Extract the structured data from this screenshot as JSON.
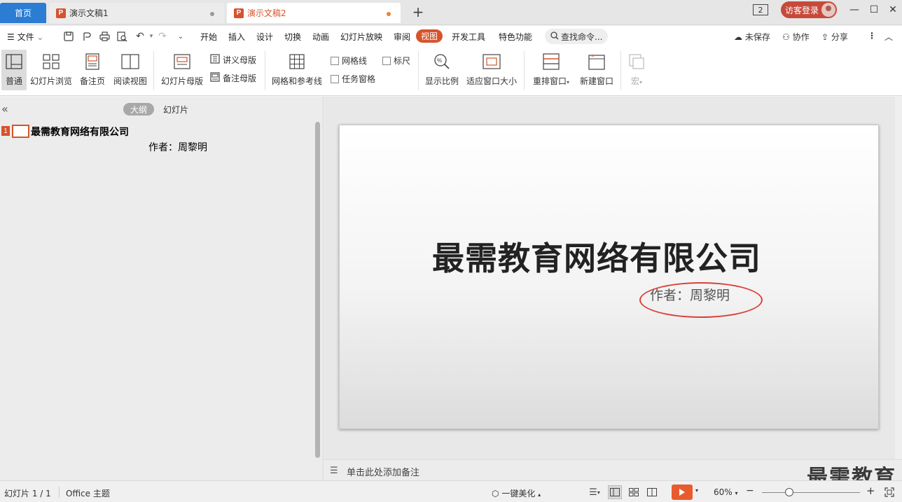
{
  "tabs": {
    "home": "首页",
    "doc1": "演示文稿1",
    "doc2": "演示文稿2",
    "badge": "P",
    "add": "+"
  },
  "titlebar": {
    "window_count": "2",
    "login": "访客登录",
    "minimize": "—",
    "maximize": "☐",
    "close": "✕"
  },
  "menu": {
    "file": "文件",
    "items": [
      "开始",
      "插入",
      "设计",
      "切换",
      "动画",
      "幻灯片放映",
      "审阅",
      "视图",
      "开发工具",
      "特色功能"
    ],
    "search": "查找命令...",
    "unsaved": "未保存",
    "collab": "协作",
    "share": "分享"
  },
  "ribbon": {
    "normal": "普通",
    "slide_browse": "幻灯片浏览",
    "notes_page": "备注页",
    "reading_view": "阅读视图",
    "slide_master": "幻灯片母版",
    "handout_master": "讲义母版",
    "notes_master": "备注母版",
    "grid_guides": "网格和参考线",
    "gridlines": "网格线",
    "ruler": "标尺",
    "task_pane": "任务窗格",
    "zoom": "显示比例",
    "fit_window": "适应窗口大小",
    "arrange": "重排窗口",
    "new_window": "新建窗口",
    "macro": "宏"
  },
  "panel": {
    "outline_tab": "大纲",
    "slides_tab": "幻灯片",
    "slide_number": "1",
    "outline_title": "最需教育网络有限公司",
    "outline_sub": "作者：周黎明"
  },
  "slide": {
    "title": "最需教育网络有限公司",
    "author": "作者：周黎明"
  },
  "notes": {
    "placeholder": "单击此处添加备注",
    "watermark": "最需教育"
  },
  "status": {
    "slide_info": "幻灯片 1 / 1",
    "theme": "Office 主题",
    "beautify": "一键美化",
    "zoom": "60%",
    "minus": "−",
    "plus": "+"
  },
  "colors": {
    "accent": "#d6532c",
    "home_tab": "#2b7cd3",
    "ellipse": "#d9403a"
  }
}
